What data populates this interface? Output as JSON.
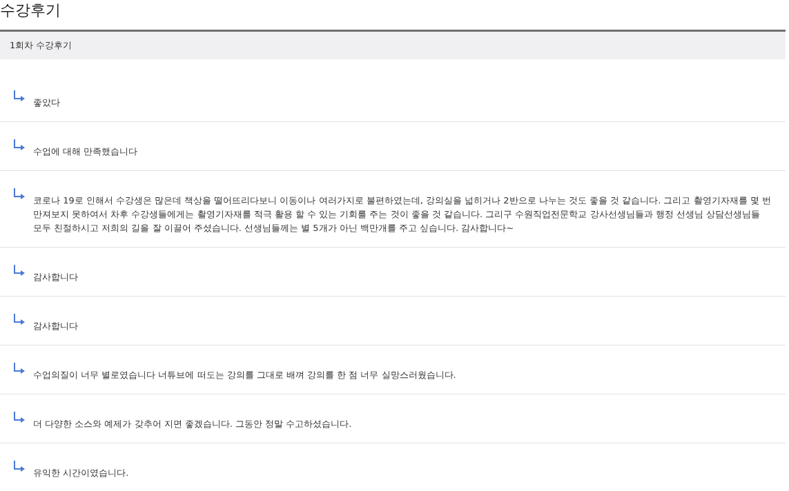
{
  "page_title": "수강후기",
  "section": {
    "title": "1회차 수강후기"
  },
  "reviews": [
    {
      "text": "좋았다"
    },
    {
      "text": "수업에 대해 만족했습니다"
    },
    {
      "text": "코로나 19로 인해서 수강생은 많은데 책상을 떨어뜨리다보니 이동이나 여러가지로 불편하였는데, 강의실을 넓히거나 2반으로 나누는 것도 좋을 것 같습니다. 그리고 촬영기자재를 몇 번 만져보지 못하여서 차후 수강생들에게는 촬영기자재를 적극 활용 할 수 있는 기회를 주는 것이 좋을 것 같습니다. 그리구 수원직업전문학교 강사선생님들과 행정 선생님 상담선생님들 모두 친절하시고 저희의 길을 잘 이끌어 주셨습니다. 선생님들께는 별 5개가 아닌 백만개를 주고 싶습니다. 감사합니다~"
    },
    {
      "text": "감사합니다"
    },
    {
      "text": "감사합니다"
    },
    {
      "text": "수업의질이 너무 별로였습니다 너튜브에 떠도는 강의를 그대로 배껴 강의를 한 점 너무 실망스러웠습니다."
    },
    {
      "text": "더 다양한 소스와 예제가 갖추어 지면 좋겠습니다. 그동안 정말 수고하셨습니다."
    },
    {
      "text": "유익한 시간이였습니다."
    }
  ]
}
